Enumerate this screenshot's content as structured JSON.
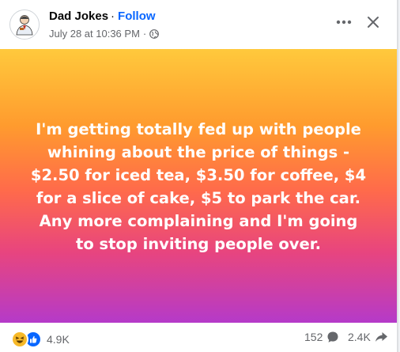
{
  "post": {
    "author": "Dad Jokes",
    "separator": "·",
    "follow_label": "Follow",
    "timestamp": "July 28 at 10:36 PM",
    "meta_separator": "·",
    "audience_icon": "globe-icon",
    "more_icon": "more-options-icon",
    "close_icon": "close-icon",
    "text": "I'm getting totally fed up with people whining about the price of things - $2.50 for iced tea, $3.50 for coffee, $4 for a slice of cake, $5 to park the car. Any more complaining and I'm going to stop inviting people over."
  },
  "engagement": {
    "reaction_icons": [
      "haha-reaction-icon",
      "like-reaction-icon"
    ],
    "reaction_count": "4.9K",
    "comment_count": "152",
    "comment_icon": "comment-icon",
    "share_count": "2.4K",
    "share_icon": "share-icon"
  },
  "colors": {
    "follow": "#0866ff",
    "secondary_text": "#65676b",
    "gradient_top": "#ffc93c",
    "gradient_middle": "#ff6a4b",
    "gradient_bottom": "#b53ac9"
  }
}
